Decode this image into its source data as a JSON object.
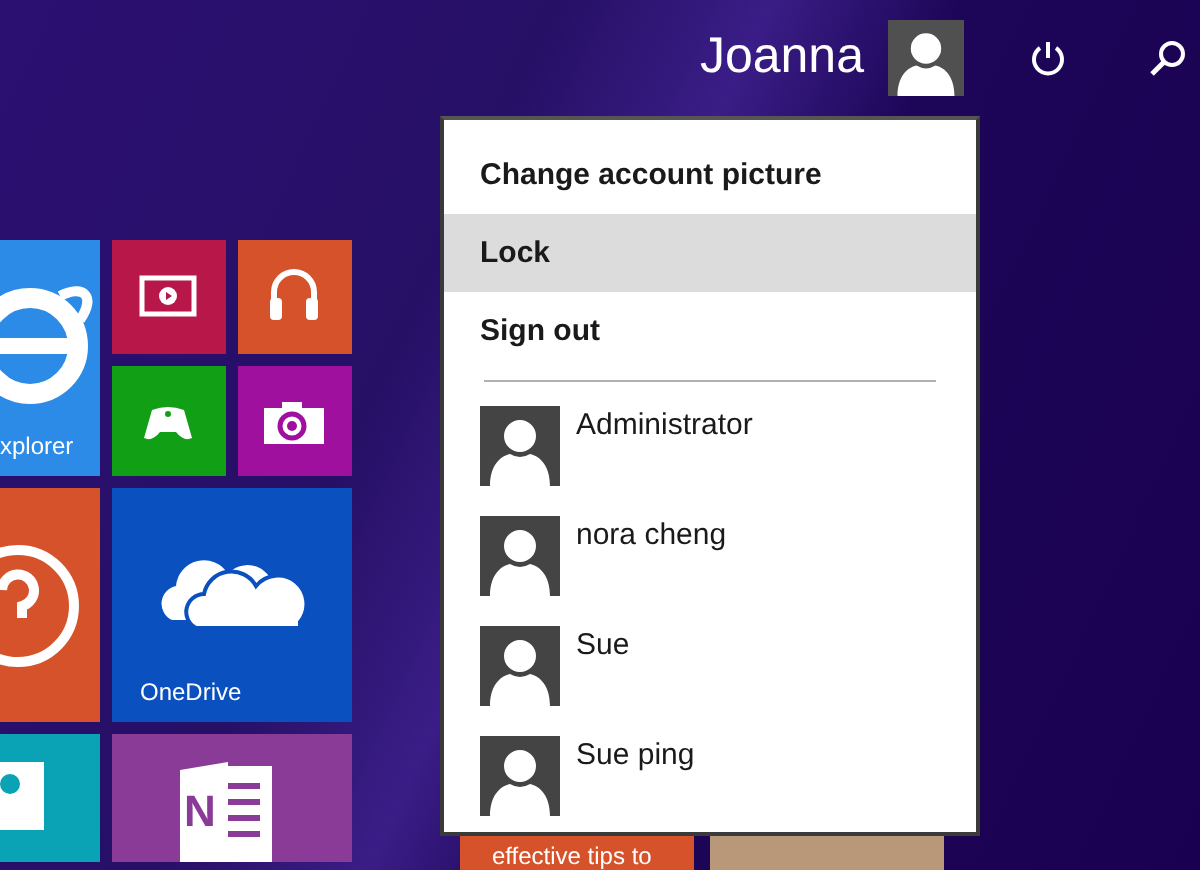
{
  "header": {
    "user_name": "Joanna"
  },
  "tiles": [
    {
      "kind": "browser",
      "label": "xplorer"
    },
    {
      "kind": "video"
    },
    {
      "kind": "music"
    },
    {
      "kind": "games"
    },
    {
      "kind": "camera"
    },
    {
      "kind": "help"
    },
    {
      "kind": "cloud",
      "label": "OneDrive"
    },
    {
      "kind": "photos"
    },
    {
      "kind": "notes",
      "icon_text": "N"
    }
  ],
  "bottom_tiles": [
    {
      "kind": "article",
      "label": "effective tips to"
    },
    {
      "kind": "photo"
    }
  ],
  "account_menu": {
    "items": [
      {
        "label": "Change account picture",
        "selected": false
      },
      {
        "label": "Lock",
        "selected": true
      },
      {
        "label": "Sign out",
        "selected": false
      }
    ],
    "users": [
      {
        "name": "Administrator"
      },
      {
        "name": "nora cheng"
      },
      {
        "name": "Sue"
      },
      {
        "name": "Sue ping"
      }
    ]
  }
}
